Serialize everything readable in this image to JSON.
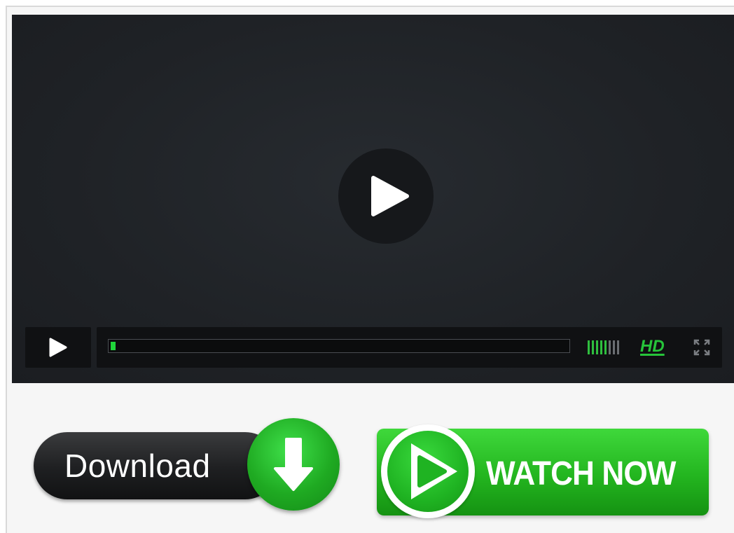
{
  "player": {
    "progress_fraction": 0.01,
    "volume_level": 5,
    "volume_max": 8,
    "hd_label": "HD"
  },
  "buttons": {
    "download_label": "Download",
    "watch_label": "WATCH NOW"
  },
  "icons": {
    "big_play": "play-icon",
    "control_play": "play-icon",
    "fullscreen": "fullscreen-icon",
    "download_arrow": "arrow-down-icon",
    "watch_play": "play-icon"
  },
  "colors": {
    "accent_green": "#26c43a",
    "player_bg": "#1f2226",
    "control_bg": "#101113"
  }
}
